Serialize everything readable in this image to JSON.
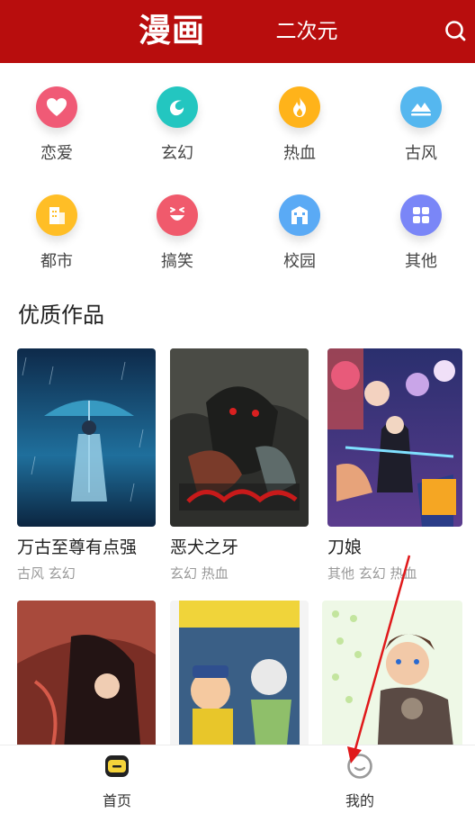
{
  "header": {
    "tab_main": "漫画",
    "tab_sub": "二次元",
    "search_icon": "search-icon"
  },
  "categories": [
    {
      "label": "恋爱",
      "icon": "heart-icon",
      "color": "#f05a76"
    },
    {
      "label": "玄幻",
      "icon": "swirl-icon",
      "color": "#23c6c0"
    },
    {
      "label": "热血",
      "icon": "flame-icon",
      "color": "#ffb31a"
    },
    {
      "label": "古风",
      "icon": "landscape-icon",
      "color": "#55b7ef"
    },
    {
      "label": "都市",
      "icon": "building-icon",
      "color": "#ffbe26"
    },
    {
      "label": "搞笑",
      "icon": "smile-icon",
      "color": "#f05a6c"
    },
    {
      "label": "校园",
      "icon": "school-icon",
      "color": "#5aaaf5"
    },
    {
      "label": "其他",
      "icon": "grid-icon",
      "color": "#7a86f7"
    }
  ],
  "section": {
    "title": "优质作品"
  },
  "works": [
    {
      "title": "万古至尊有点强",
      "tags": "古风 玄幻"
    },
    {
      "title": "恶犬之牙",
      "tags": "玄幻 热血"
    },
    {
      "title": "刀娘",
      "tags": "其他 玄幻 热血"
    },
    {
      "title": "",
      "tags": ""
    },
    {
      "title": "",
      "tags": ""
    },
    {
      "title": "",
      "tags": ""
    }
  ],
  "nav": {
    "home_label": "首页",
    "mine_label": "我的"
  },
  "colors": {
    "brand": "#b80d0d",
    "annotation_arrow": "#e0191b"
  }
}
